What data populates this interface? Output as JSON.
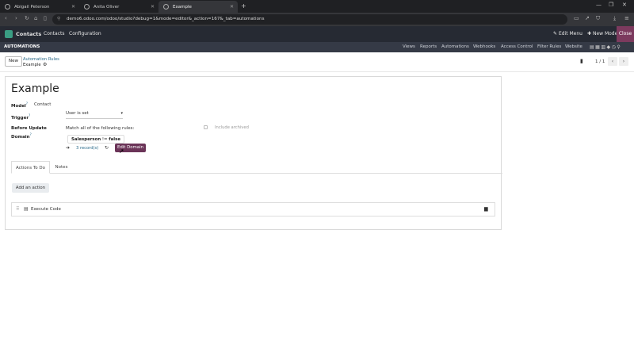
{
  "browser": {
    "tabs": [
      {
        "label": "Abigail Peterson"
      },
      {
        "label": "Anita Oliver"
      },
      {
        "label": "Example"
      }
    ],
    "url": "demo6.odoo.com/odoo/studio?debug=1&mode=editor&_action=167&_tab=automations"
  },
  "navbar": {
    "app": "Contacts",
    "menu": [
      "Contacts",
      "Configuration"
    ],
    "edit_menu": "Edit Menu",
    "new_model": "New Model",
    "close": "Close"
  },
  "studio": {
    "brand": "AUTOMATIONS",
    "items": [
      "Views",
      "Reports",
      "Automations",
      "Webhooks",
      "Access Control",
      "Filter Rules",
      "Website"
    ]
  },
  "control_panel": {
    "new_label": "New",
    "breadcrumb_parent": "Automation Rules",
    "breadcrumb_current": "Example",
    "pager": "1 / 1"
  },
  "form": {
    "title": "Example",
    "model_label": "Model",
    "model_value": "Contact",
    "trigger_label": "Trigger",
    "trigger_value": "User is set",
    "before_update_label": "Before Update",
    "domain_label": "Domain",
    "match_text": "Match all of the following rules:",
    "include_archived": "Include archived",
    "rule_field": "Salesperson",
    "rule_op": "!=",
    "rule_value": "false",
    "records": "3 record(s)",
    "edit_domain": "Edit Domain",
    "tabs": [
      "Actions To Do",
      "Notes"
    ],
    "add_action": "Add an action",
    "actions": [
      {
        "name": "Execute Code"
      }
    ]
  }
}
